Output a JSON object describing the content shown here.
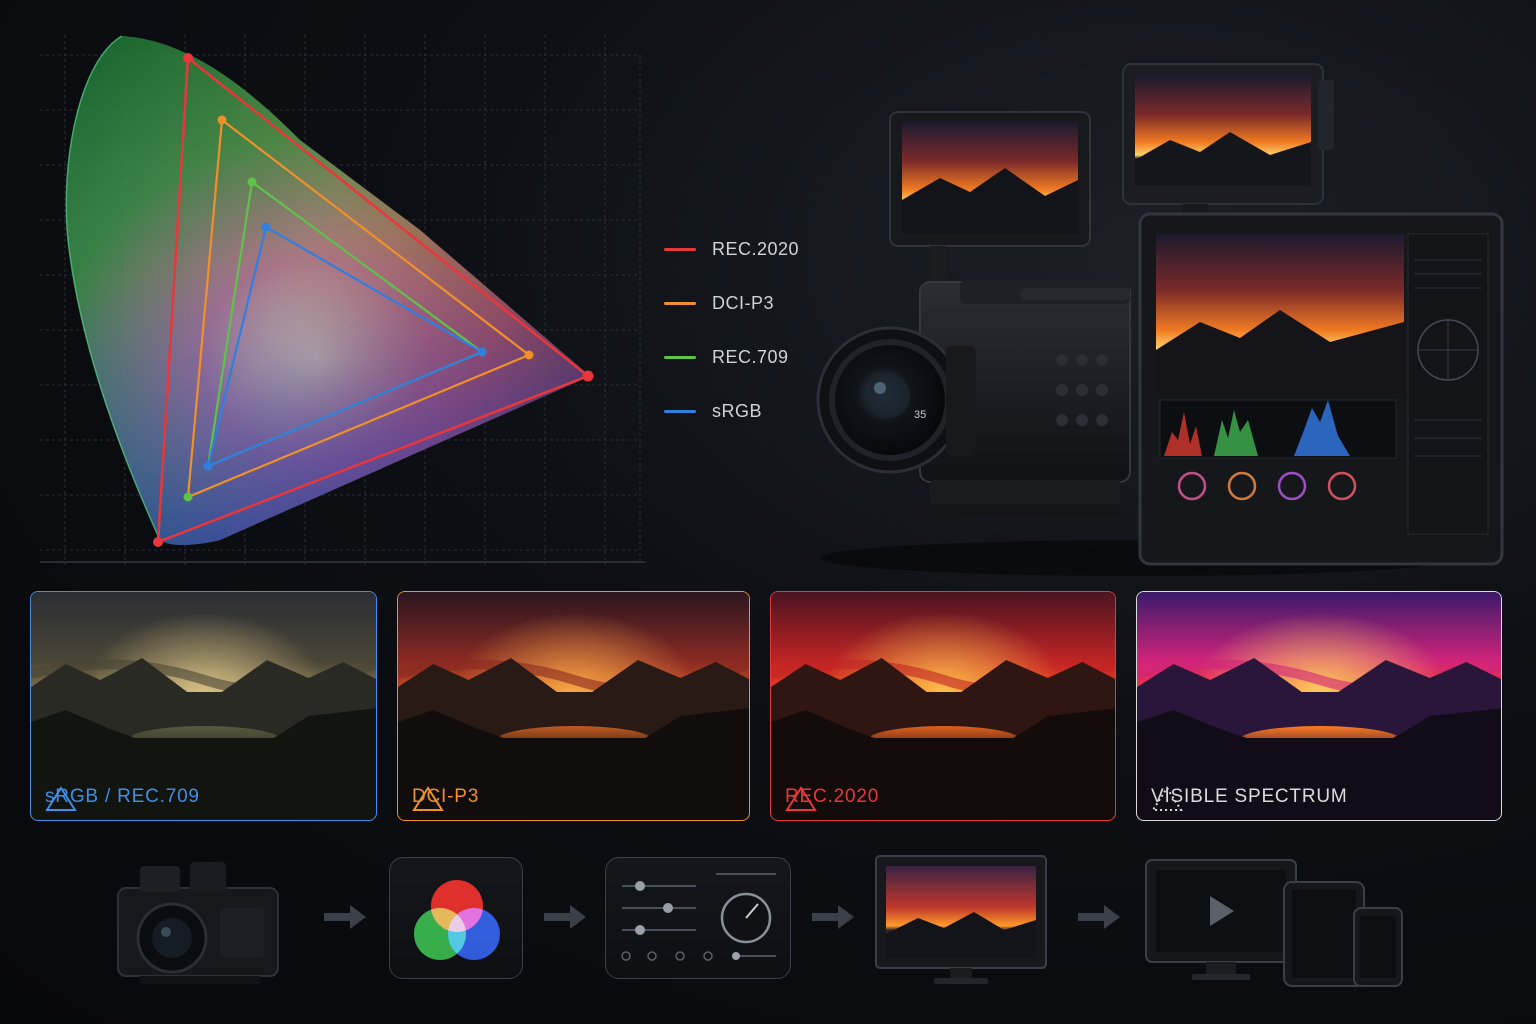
{
  "legend": [
    {
      "label": "REC.2020",
      "color": "#e8373a"
    },
    {
      "label": "DCI-P3",
      "color": "#f0902a"
    },
    {
      "label": "REC.709",
      "color": "#5fc34a"
    },
    {
      "label": "sRGB",
      "color": "#2f7fe0"
    }
  ],
  "panels": [
    {
      "label": "sRGB / REC.709",
      "color": "#3f8fe6",
      "saturation": "low"
    },
    {
      "label": "DCI-P3",
      "color": "#f0902a",
      "saturation": "medium"
    },
    {
      "label": "REC.2020",
      "color": "#e8373a",
      "saturation": "high"
    },
    {
      "label": "VISIBLE SPECTRUM",
      "color": "#dcdcdc",
      "saturation": "max"
    }
  ],
  "camera": {
    "lens_marking": "35"
  },
  "workflow": [
    "cinema-camera",
    "rgb-color-mixing",
    "grading-controls",
    "reference-monitor",
    "multi-device-delivery"
  ]
}
